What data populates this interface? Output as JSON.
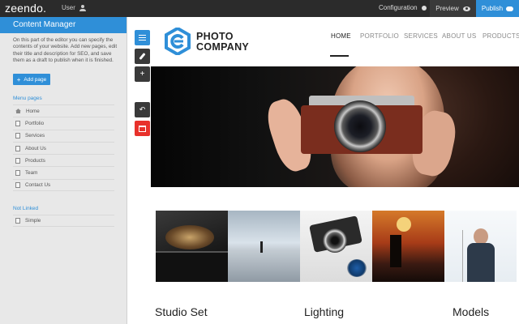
{
  "topbar": {
    "logo": "zeendo.",
    "user_label": "User",
    "configuration_label": "Configuration",
    "preview_label": "Preview",
    "publish_label": "Publish",
    "accent_color": "#2f8fd8"
  },
  "sidebar": {
    "title": "Content Manager",
    "description": "On this part of the editor you can specify the contents of your website. Add new pages, edit their title and description for SEO, and save them as a draft to publish when it is finished.",
    "add_page_label": "Add page",
    "menu_pages_title": "Menu pages",
    "menu_pages": [
      {
        "label": "Home",
        "icon": "home-icon"
      },
      {
        "label": "Portfolio",
        "icon": "page-icon"
      },
      {
        "label": "Services",
        "icon": "page-icon"
      },
      {
        "label": "About Us",
        "icon": "page-icon"
      },
      {
        "label": "Products",
        "icon": "page-icon"
      },
      {
        "label": "Team",
        "icon": "page-icon"
      },
      {
        "label": "Contact Us",
        "icon": "page-icon"
      }
    ],
    "not_linked_title": "Not Linked",
    "not_linked_pages": [
      {
        "label": "Simple",
        "icon": "page-icon"
      }
    ]
  },
  "toolbar": {
    "tools": [
      "menu-icon",
      "brush-icon",
      "plus-icon",
      "undo-icon",
      "calendar-icon"
    ]
  },
  "site": {
    "brand_line1": "PHOTO",
    "brand_line2": "COMPANY",
    "nav": [
      "HOME",
      "PORTFOLIO",
      "SERVICES",
      "ABOUT US",
      "PRODUCTS"
    ],
    "active_nav": "HOME",
    "captions": [
      "Studio Set",
      "Lighting",
      "Models"
    ]
  }
}
